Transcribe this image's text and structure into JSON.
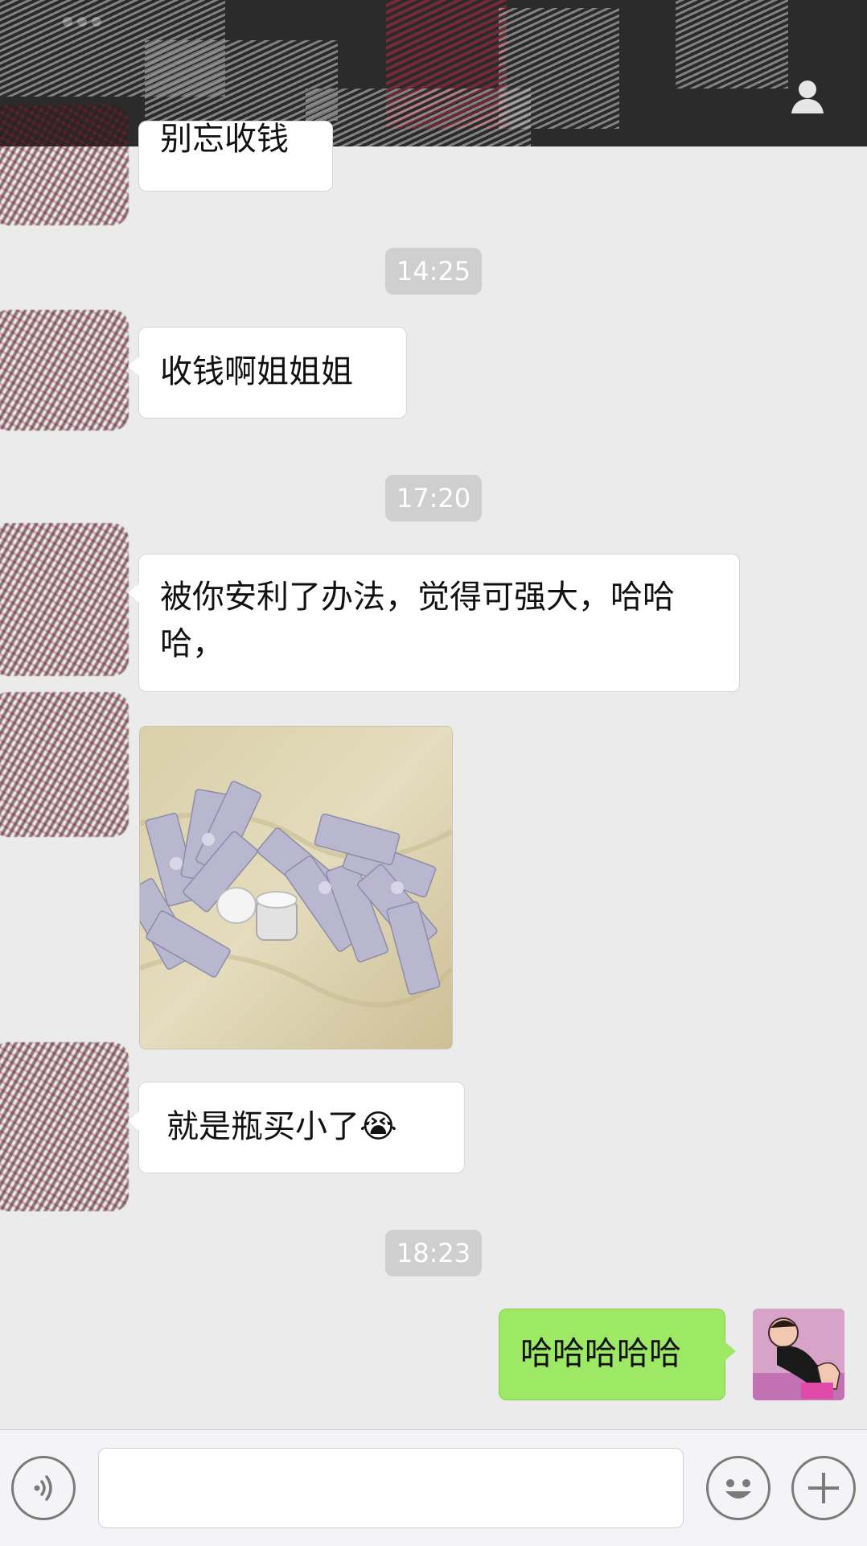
{
  "header": {
    "title": "",
    "status_dots": [
      "dot",
      "dot",
      "dot"
    ],
    "profile_icon": "person-icon"
  },
  "messages": [
    {
      "type": "text",
      "side": "left",
      "text": "别忘收钱"
    },
    {
      "type": "time",
      "text": "14:25"
    },
    {
      "type": "text",
      "side": "left",
      "text": "收钱啊姐姐姐"
    },
    {
      "type": "time",
      "text": "17:20"
    },
    {
      "type": "text",
      "side": "left",
      "text": "被你安利了办法，觉得可强大，哈哈哈，"
    },
    {
      "type": "image",
      "side": "left",
      "description_icon": "photo-icon"
    },
    {
      "type": "text",
      "side": "left",
      "text": "就是瓶买小了",
      "emoji": "😭"
    },
    {
      "type": "time",
      "text": "18:23"
    },
    {
      "type": "text",
      "side": "right",
      "text": "哈哈哈哈哈"
    }
  ],
  "input_bar": {
    "voice_icon": "voice-icon",
    "emoji_icon": "emoji-icon",
    "plus_icon": "plus-icon",
    "placeholder": ""
  },
  "colors": {
    "background": "#ebebeb",
    "header": "#2b2b2b",
    "bubble_left": "#ffffff",
    "bubble_right": "#9de864",
    "time_pill": "#cfcfcf"
  }
}
